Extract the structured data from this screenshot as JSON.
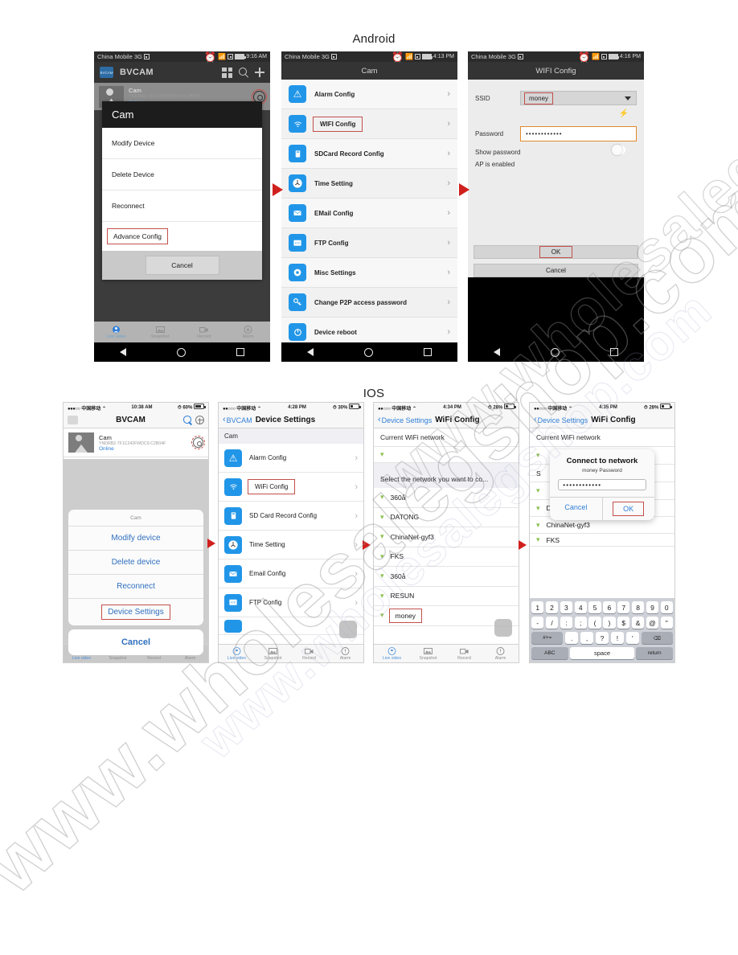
{
  "headings": {
    "android": "Android",
    "ios": "IOS"
  },
  "watermark": {
    "line": "www.wholesalegshop.com"
  },
  "android": {
    "phone1": {
      "status": {
        "carrier": "China Mobile 3G",
        "time": "9:16 AM"
      },
      "appbar": {
        "logo": "BVCAM",
        "title": "BVCAM",
        "grid_icon": "grid-icon",
        "search_icon": "search-icon",
        "add_icon": "plus-icon"
      },
      "device": {
        "name": "Cam",
        "id": "YNDRB2-7F1C242FWDC9-C2B04F",
        "status": "Online",
        "gear_icon": "gear-icon"
      },
      "dialog": {
        "title": "Cam",
        "items": [
          "Modify Device",
          "Delete Device",
          "Reconnect",
          "Advance Config"
        ],
        "highlighted": "Advance Config",
        "cancel": "Cancel"
      },
      "tabs": [
        {
          "label": "Live video",
          "icon": "live-video-icon"
        },
        {
          "label": "Snapshot",
          "icon": "snapshot-icon"
        },
        {
          "label": "Record",
          "icon": "record-icon"
        },
        {
          "label": "Alarm",
          "icon": "alarm-icon"
        }
      ]
    },
    "phone2": {
      "status": {
        "carrier": "China Mobile 3G",
        "time": "4:13 PM"
      },
      "title": "Cam",
      "items": [
        {
          "label": "Alarm Config",
          "icon": "alarm-warning-icon"
        },
        {
          "label": "WIFI Config",
          "icon": "wifi-icon"
        },
        {
          "label": "SDCard Record Config",
          "icon": "sdcard-icon"
        },
        {
          "label": "Time Setting",
          "icon": "clock-icon"
        },
        {
          "label": "EMail Config",
          "icon": "email-icon"
        },
        {
          "label": "FTP Config",
          "icon": "ftp-icon"
        },
        {
          "label": "Misc Settings",
          "icon": "gear-icon"
        },
        {
          "label": "Change P2P access password",
          "icon": "key-icon"
        },
        {
          "label": "Device reboot",
          "icon": "reboot-icon"
        }
      ],
      "highlighted": "WIFI Config"
    },
    "phone3": {
      "status": {
        "carrier": "China Mobile 3G",
        "time": "4:16 PM"
      },
      "title": "WIFI Config",
      "form": {
        "ssid_label": "SSID",
        "ssid_value": "money",
        "password_label": "Password",
        "password_value": "••••••••••••",
        "show_password_label": "Show password",
        "ap_enabled_label": "AP is enabled"
      },
      "buttons": {
        "ok": "OK",
        "cancel": "Cancel"
      }
    }
  },
  "ios": {
    "phone1": {
      "status": {
        "dots": "●●●○○",
        "carrier": "中国移动",
        "time": "10:38 AM",
        "battery": "60%"
      },
      "nav": {
        "title": "BVCAM",
        "search_icon": "search-icon",
        "add_icon": "plus-circle-icon"
      },
      "device": {
        "name": "Cam",
        "id": "YNDRB2-7F1C242FWDC9-C2B04F",
        "status": "Online",
        "gear_icon": "gear-icon"
      },
      "sheet": {
        "title": "Cam",
        "items": [
          "Modify device",
          "Delete device",
          "Reconnect",
          "Device Settings"
        ],
        "highlighted": "Device Settings",
        "cancel": "Cancel"
      },
      "tabs": [
        {
          "label": "Live video",
          "icon": "live-video-icon"
        },
        {
          "label": "Snapshot",
          "icon": "snapshot-icon"
        },
        {
          "label": "Record",
          "icon": "record-icon"
        },
        {
          "label": "Alarm",
          "icon": "alarm-icon"
        }
      ]
    },
    "phone2": {
      "status": {
        "dots": "●●○○○",
        "carrier": "中国移动",
        "time": "4:28 PM",
        "battery": "30%"
      },
      "nav": {
        "back": "BVCAM",
        "title": "Device Settings"
      },
      "group_header": "Cam",
      "items": [
        {
          "label": "Alarm Config",
          "icon": "alarm-warning-icon"
        },
        {
          "label": "WiFi Config",
          "icon": "wifi-icon"
        },
        {
          "label": "SD Card Record Config",
          "icon": "sdcard-icon"
        },
        {
          "label": "Time Setting",
          "icon": "clock-icon"
        },
        {
          "label": "Email Config",
          "icon": "email-icon"
        },
        {
          "label": "FTP Config",
          "icon": "ftp-icon"
        }
      ],
      "highlighted": "WiFi Config",
      "tabs": [
        {
          "label": "Live video",
          "icon": "live-video-icon"
        },
        {
          "label": "Snapshot",
          "icon": "snapshot-icon"
        },
        {
          "label": "Record",
          "icon": "record-icon"
        },
        {
          "label": "Alarm",
          "icon": "alarm-icon"
        }
      ]
    },
    "phone3": {
      "status": {
        "dots": "●●○○○",
        "carrier": "中国移动",
        "time": "4:34 PM",
        "battery": "28%"
      },
      "nav": {
        "back": "Device Settings",
        "title": "WiFi Config"
      },
      "current_header": "Current WiFi network",
      "select_header": "Select the network you want to co...",
      "networks": [
        "360å",
        "DATONG",
        "ChinaNet-gyf3",
        "FKS",
        "360å",
        "RESUN",
        "money"
      ],
      "highlighted": "money",
      "tabs": [
        {
          "label": "Live video",
          "icon": "live-video-icon"
        },
        {
          "label": "Snapshot",
          "icon": "snapshot-icon"
        },
        {
          "label": "Record",
          "icon": "record-icon"
        },
        {
          "label": "Alarm",
          "icon": "alarm-icon"
        }
      ]
    },
    "phone4": {
      "status": {
        "dots": "●●○○○",
        "carrier": "中国移动",
        "time": "4:35 PM",
        "battery": "28%"
      },
      "nav": {
        "back": "Device Settings",
        "title": "WiFi Config"
      },
      "current_header": "Current WiFi network",
      "networks": [
        "DATONG",
        "ChinaNet-gyf3",
        "FKS"
      ],
      "alert": {
        "title": "Connect to network",
        "subtitle": "money Password",
        "password_value": "••••••••••••",
        "cancel": "Cancel",
        "ok": "OK",
        "highlighted": "OK"
      },
      "keyboard": {
        "row1": [
          "1",
          "2",
          "3",
          "4",
          "5",
          "6",
          "7",
          "8",
          "9",
          "0"
        ],
        "row2": [
          "-",
          "/",
          ":",
          ";",
          "(",
          ")",
          "$",
          "&",
          "@",
          "\""
        ],
        "row3": [
          "#+=",
          ".",
          ",",
          "?",
          "!",
          "'",
          "⌫"
        ],
        "row4": [
          "ABC",
          "space",
          "return"
        ]
      }
    }
  },
  "colors": {
    "accent_red": "#d0201d",
    "ios_blue": "#2f7fd8",
    "icon_blue": "#2196e8",
    "highlight_orange": "#e08a2e"
  }
}
